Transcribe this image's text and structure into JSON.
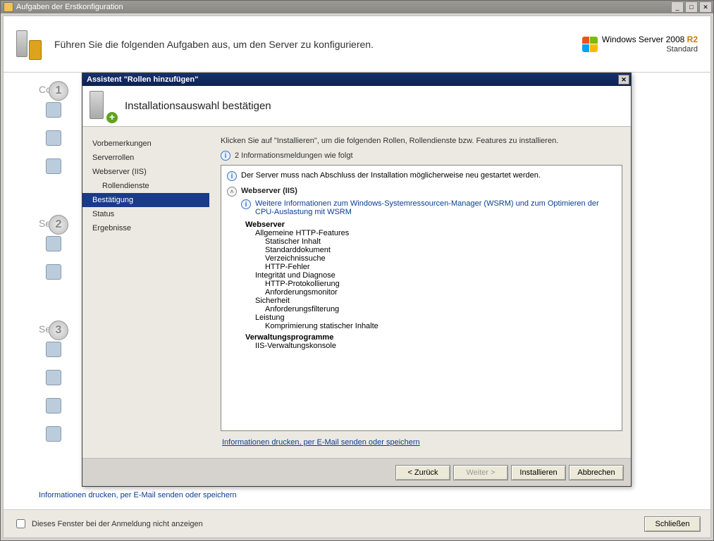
{
  "outer_window": {
    "title": "Aufgaben der Erstkonfiguration"
  },
  "window_controls": {
    "minimize": "_",
    "maximize": "□",
    "close": "✕"
  },
  "banner": {
    "text": "Führen Sie die folgenden Aufgaben aus, um den Server zu konfigurieren.",
    "brand_line1a": "Windows",
    "brand_line1b": "Server",
    "brand_year": "2008",
    "brand_r2": "R2",
    "brand_edition": "Standard"
  },
  "steps": [
    {
      "num": "1",
      "title": "Com",
      "items": [
        {
          "label": ""
        },
        {
          "label": ""
        },
        {
          "label": ""
        }
      ]
    },
    {
      "num": "2",
      "title": "Serv",
      "items": [
        {
          "label": ""
        },
        {
          "label": ""
        }
      ]
    },
    {
      "num": "3",
      "title": "Serv",
      "items": [
        {
          "label": ""
        },
        {
          "label": ""
        },
        {
          "label": ""
        },
        {
          "label": ""
        }
      ]
    }
  ],
  "info_link": "Informationen drucken, per E-Mail senden oder speichern",
  "footer": {
    "checkbox_label": "Dieses Fenster bei der Anmeldung nicht anzeigen",
    "close_button": "Schließen"
  },
  "wizard": {
    "title": "Assistent \"Rollen hinzufügen\"",
    "header": "Installationsauswahl bestätigen",
    "nav": [
      {
        "label": "Vorbemerkungen",
        "sub": false,
        "sel": false
      },
      {
        "label": "Serverrollen",
        "sub": false,
        "sel": false
      },
      {
        "label": "Webserver (IIS)",
        "sub": false,
        "sel": false
      },
      {
        "label": "Rollendienste",
        "sub": true,
        "sel": false
      },
      {
        "label": "Bestätigung",
        "sub": false,
        "sel": true
      },
      {
        "label": "Status",
        "sub": false,
        "sel": false
      },
      {
        "label": "Ergebnisse",
        "sub": false,
        "sel": false
      }
    ],
    "instruction": "Klicken Sie auf \"Installieren\", um die folgenden Rollen, Rollendienste bzw. Features zu installieren.",
    "info_count_line": "2 Informationsmeldungen wie folgt",
    "restart_note": "Der Server muss nach Abschluss der Installation möglicherweise neu gestartet werden.",
    "role_header": "Webserver (IIS)",
    "wsrm_note": "Weitere Informationen zum Windows-Systemressourcen-Manager (WSRM) und zum Optimieren der CPU-Auslastung mit WSRM",
    "tree": {
      "webserver": "Webserver",
      "http_features": "Allgemeine HTTP-Features",
      "static_content": "Statischer Inhalt",
      "default_doc": "Standarddokument",
      "dir_browsing": "Verzeichnissuche",
      "http_errors": "HTTP-Fehler",
      "health": "Integrität und Diagnose",
      "http_logging": "HTTP-Protokollierung",
      "request_monitor": "Anforderungsmonitor",
      "security": "Sicherheit",
      "request_filtering": "Anforderungsfilterung",
      "performance": "Leistung",
      "static_compression": "Komprimierung statischer Inhalte",
      "management_tools": "Verwaltungsprogramme",
      "iis_console": "IIS-Verwaltungskonsole"
    },
    "print_link": "Informationen drucken, per E-Mail senden oder speichern",
    "buttons": {
      "back": "< Zurück",
      "next": "Weiter >",
      "install": "Installieren",
      "cancel": "Abbrechen"
    }
  }
}
